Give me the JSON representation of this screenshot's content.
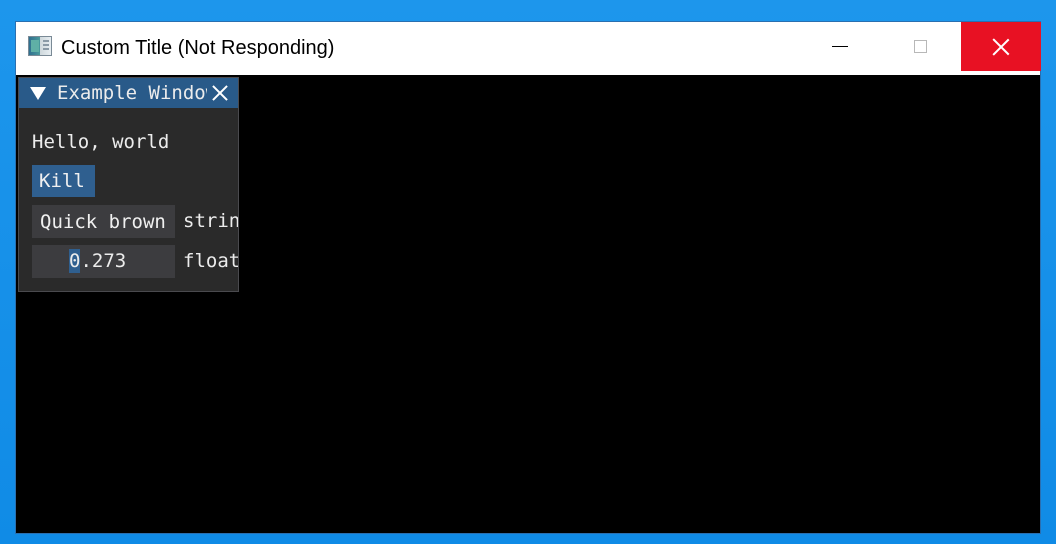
{
  "window": {
    "title": "Custom Title (Not Responding)"
  },
  "icons": {
    "app": "app-icon",
    "minimize": "minimize-icon",
    "maximize": "maximize-icon",
    "close": "close-icon"
  },
  "colors": {
    "desktop": "#1a8ee8",
    "titlebar": "#ffffff",
    "close_hover": "#e81123",
    "imgui_title": "#295a89",
    "imgui_bg": "#2a2a2a",
    "button": "#2f5f8f",
    "frame": "#3c3c3f"
  },
  "imgui": {
    "title": "Example Window",
    "text": "Hello, world",
    "button_label": "Kill",
    "string_value": "Quick brown",
    "string_label": "string",
    "float_value_first": "0",
    "float_value_rest": ".273",
    "float_label": "float"
  }
}
